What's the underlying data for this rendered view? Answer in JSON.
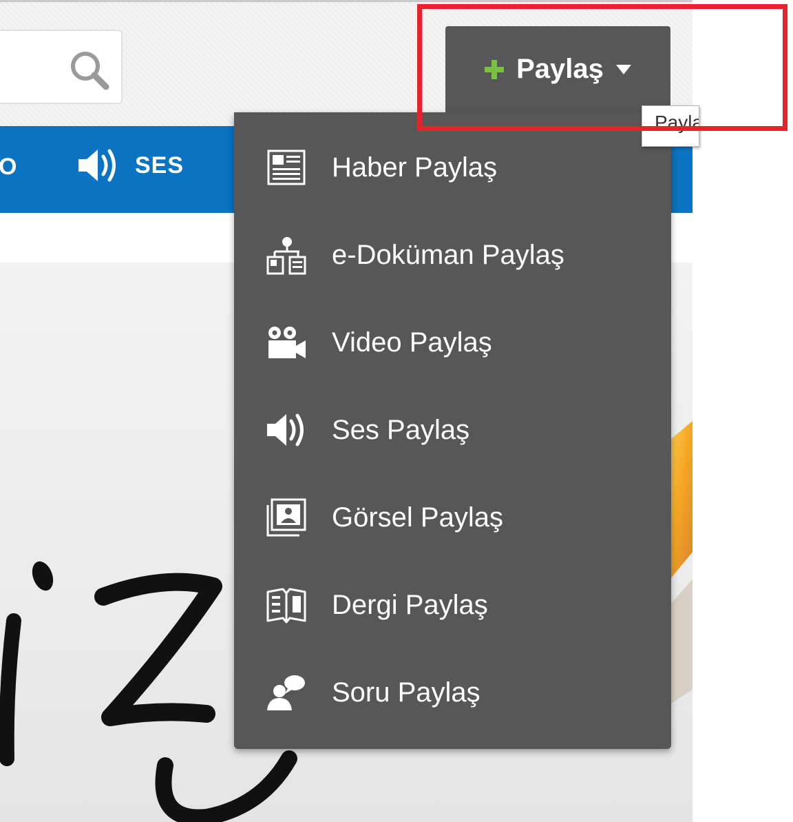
{
  "header": {
    "share_button_label": "Paylaş",
    "tooltip_text": "Paylaş"
  },
  "nav": {
    "partial_item": "O",
    "ses_label": "SES"
  },
  "share_menu": {
    "items": [
      {
        "label": "Haber Paylaş",
        "icon": "newspaper-icon"
      },
      {
        "label": "e-Doküman Paylaş",
        "icon": "document-network-icon"
      },
      {
        "label": "Video Paylaş",
        "icon": "video-camera-icon"
      },
      {
        "label": "Ses Paylaş",
        "icon": "speaker-icon"
      },
      {
        "label": "Görsel Paylaş",
        "icon": "image-icon"
      },
      {
        "label": "Dergi Paylaş",
        "icon": "magazine-icon"
      },
      {
        "label": "Soru Paylaş",
        "icon": "question-user-icon"
      }
    ]
  },
  "colors": {
    "nav_blue": "#0a73c2",
    "menu_bg": "#575757",
    "plus_green": "#7ac142",
    "highlight_red": "#e8212d"
  }
}
